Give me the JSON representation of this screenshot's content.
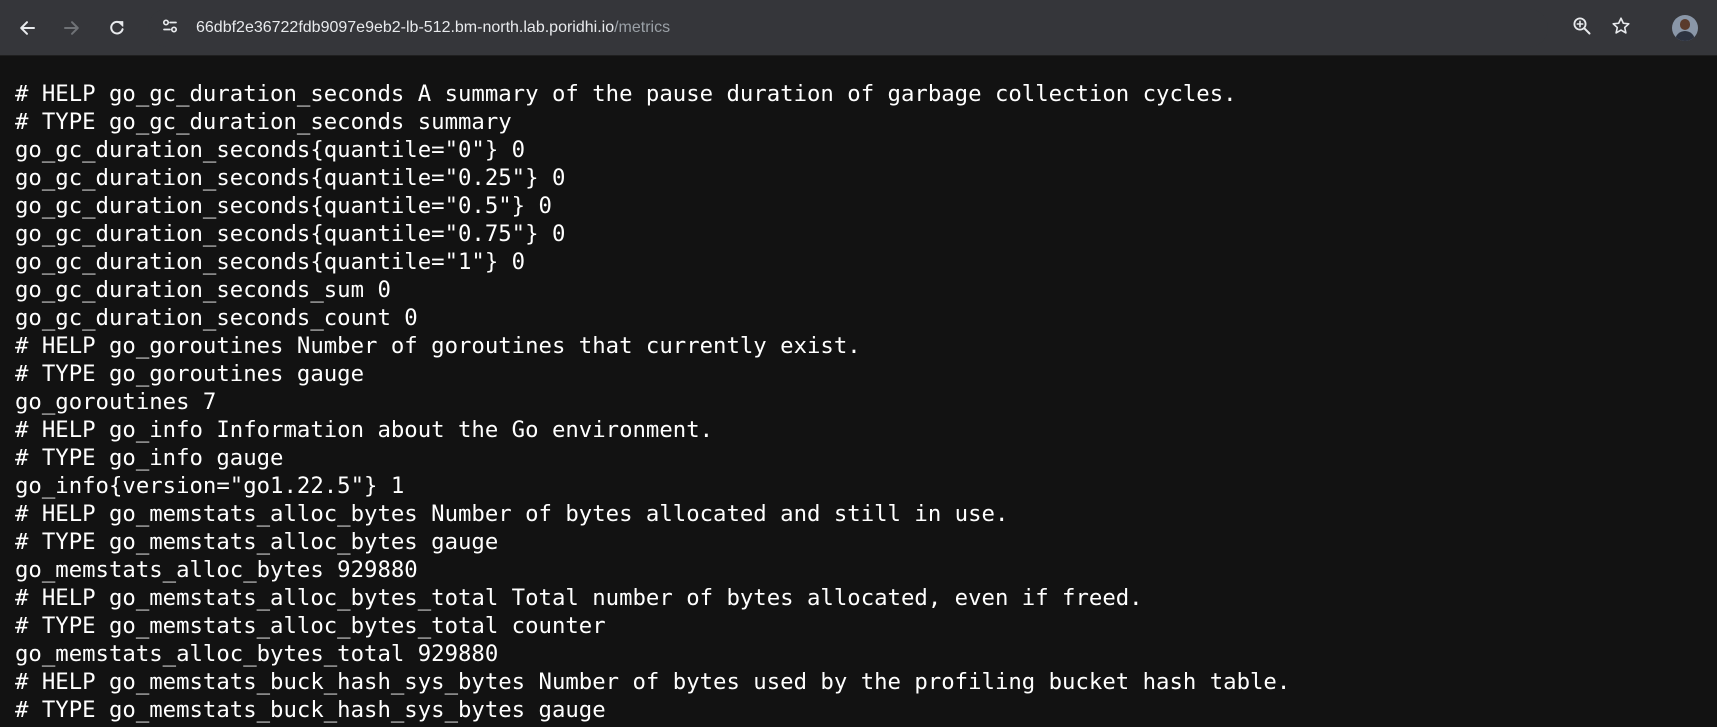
{
  "browser": {
    "url_host": "66dbf2e36722fdb9097e9eb2-lb-512.bm-north.lab.poridhi.io",
    "url_path": "/metrics",
    "icons": {
      "back": "arrow-left-icon",
      "forward": "arrow-right-icon",
      "reload": "reload-icon",
      "site_info": "tune-icon",
      "zoom": "zoom-in-icon",
      "bookmark": "star-icon",
      "profile": "avatar"
    }
  },
  "metrics_lines": [
    "# HELP go_gc_duration_seconds A summary of the pause duration of garbage collection cycles.",
    "# TYPE go_gc_duration_seconds summary",
    "go_gc_duration_seconds{quantile=\"0\"} 0",
    "go_gc_duration_seconds{quantile=\"0.25\"} 0",
    "go_gc_duration_seconds{quantile=\"0.5\"} 0",
    "go_gc_duration_seconds{quantile=\"0.75\"} 0",
    "go_gc_duration_seconds{quantile=\"1\"} 0",
    "go_gc_duration_seconds_sum 0",
    "go_gc_duration_seconds_count 0",
    "# HELP go_goroutines Number of goroutines that currently exist.",
    "# TYPE go_goroutines gauge",
    "go_goroutines 7",
    "# HELP go_info Information about the Go environment.",
    "# TYPE go_info gauge",
    "go_info{version=\"go1.22.5\"} 1",
    "# HELP go_memstats_alloc_bytes Number of bytes allocated and still in use.",
    "# TYPE go_memstats_alloc_bytes gauge",
    "go_memstats_alloc_bytes 929880",
    "# HELP go_memstats_alloc_bytes_total Total number of bytes allocated, even if freed.",
    "# TYPE go_memstats_alloc_bytes_total counter",
    "go_memstats_alloc_bytes_total 929880",
    "# HELP go_memstats_buck_hash_sys_bytes Number of bytes used by the profiling bucket hash table.",
    "# TYPE go_memstats_buck_hash_sys_bytes gauge"
  ]
}
